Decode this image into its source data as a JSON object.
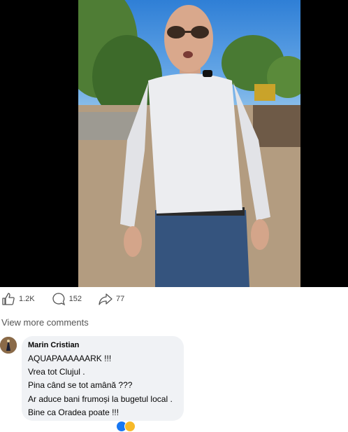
{
  "post": {
    "reactions_count": "1.2K",
    "comments_count": "152",
    "shares_count": "77"
  },
  "view_more_comments": "View more comments",
  "comment": {
    "author": "Marin Cristian",
    "lines": [
      "AQUAPAAAAAARK !!!",
      "Vrea tot Clujul .",
      "Pina când se tot amână ???",
      "Ar aduce bani frumoși la bugetul local .",
      "Bine ca Oradea poate !!!"
    ]
  },
  "icons": {
    "like": "thumbs-up-icon",
    "comment": "speech-bubble-icon",
    "share": "share-arrow-icon"
  },
  "colors": {
    "bubble": "#f0f2f5",
    "text": "#050505",
    "muted": "#65676b",
    "like_blue": "#1877f2",
    "love_red": "#f33e58",
    "haha_yellow": "#f7b928"
  }
}
